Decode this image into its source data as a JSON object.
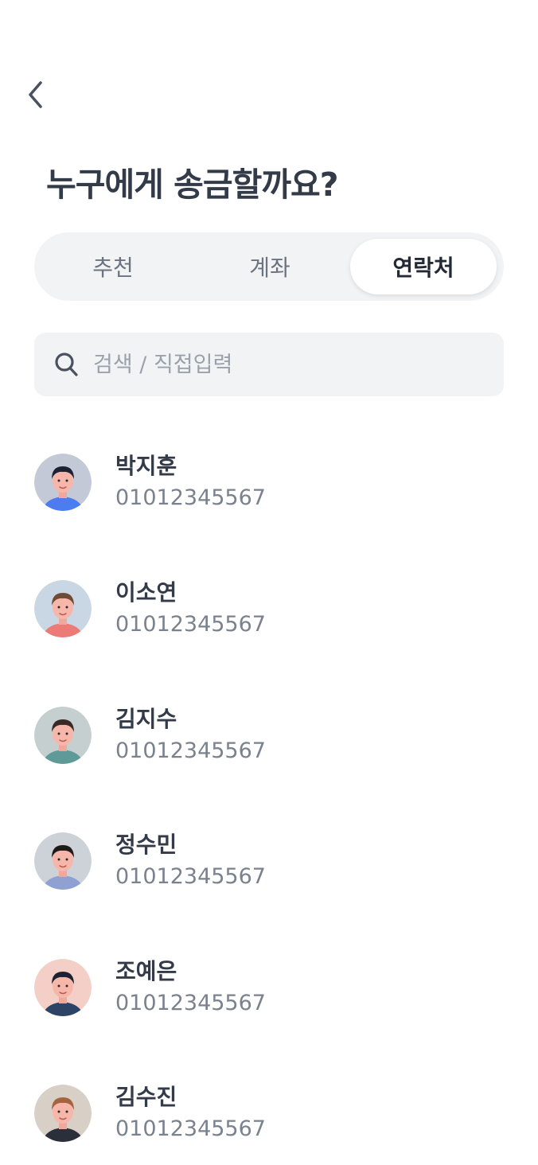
{
  "header": {
    "back_icon": "chevron-left-icon"
  },
  "title": "누구에게 송금할까요?",
  "tabs": [
    {
      "label": "추천",
      "active": false
    },
    {
      "label": "계좌",
      "active": false
    },
    {
      "label": "연락처",
      "active": true
    }
  ],
  "search": {
    "placeholder": "검색 / 직접입력",
    "value": "",
    "icon": "search-icon"
  },
  "contacts": [
    {
      "name": "박지훈",
      "phone": "01012345567",
      "avatar_bg": "#c3c9d6",
      "shirt": "#4b7cf0",
      "hair": "#1c2233"
    },
    {
      "name": "이소연",
      "phone": "01012345567",
      "avatar_bg": "#c9d6e3",
      "shirt": "#ec7b78",
      "hair": "#6f4a36"
    },
    {
      "name": "김지수",
      "phone": "01012345567",
      "avatar_bg": "#c6cfcf",
      "shirt": "#5e9a98",
      "hair": "#3a2a26"
    },
    {
      "name": "정수민",
      "phone": "01012345567",
      "avatar_bg": "#cdd2d8",
      "shirt": "#8fa1d3",
      "hair": "#1f1a1a"
    },
    {
      "name": "조예은",
      "phone": "01012345567",
      "avatar_bg": "#f4cfc7",
      "shirt": "#2e4466",
      "hair": "#1c2233"
    },
    {
      "name": "김수진",
      "phone": "01012345567",
      "avatar_bg": "#d8cfc6",
      "shirt": "#2a2f3a",
      "hair": "#a4643f"
    }
  ],
  "colors": {
    "active_tab_bg": "#ffffff",
    "tab_bar_bg": "#f2f3f5",
    "text_primary": "#333a48",
    "text_secondary": "#7a828e"
  }
}
